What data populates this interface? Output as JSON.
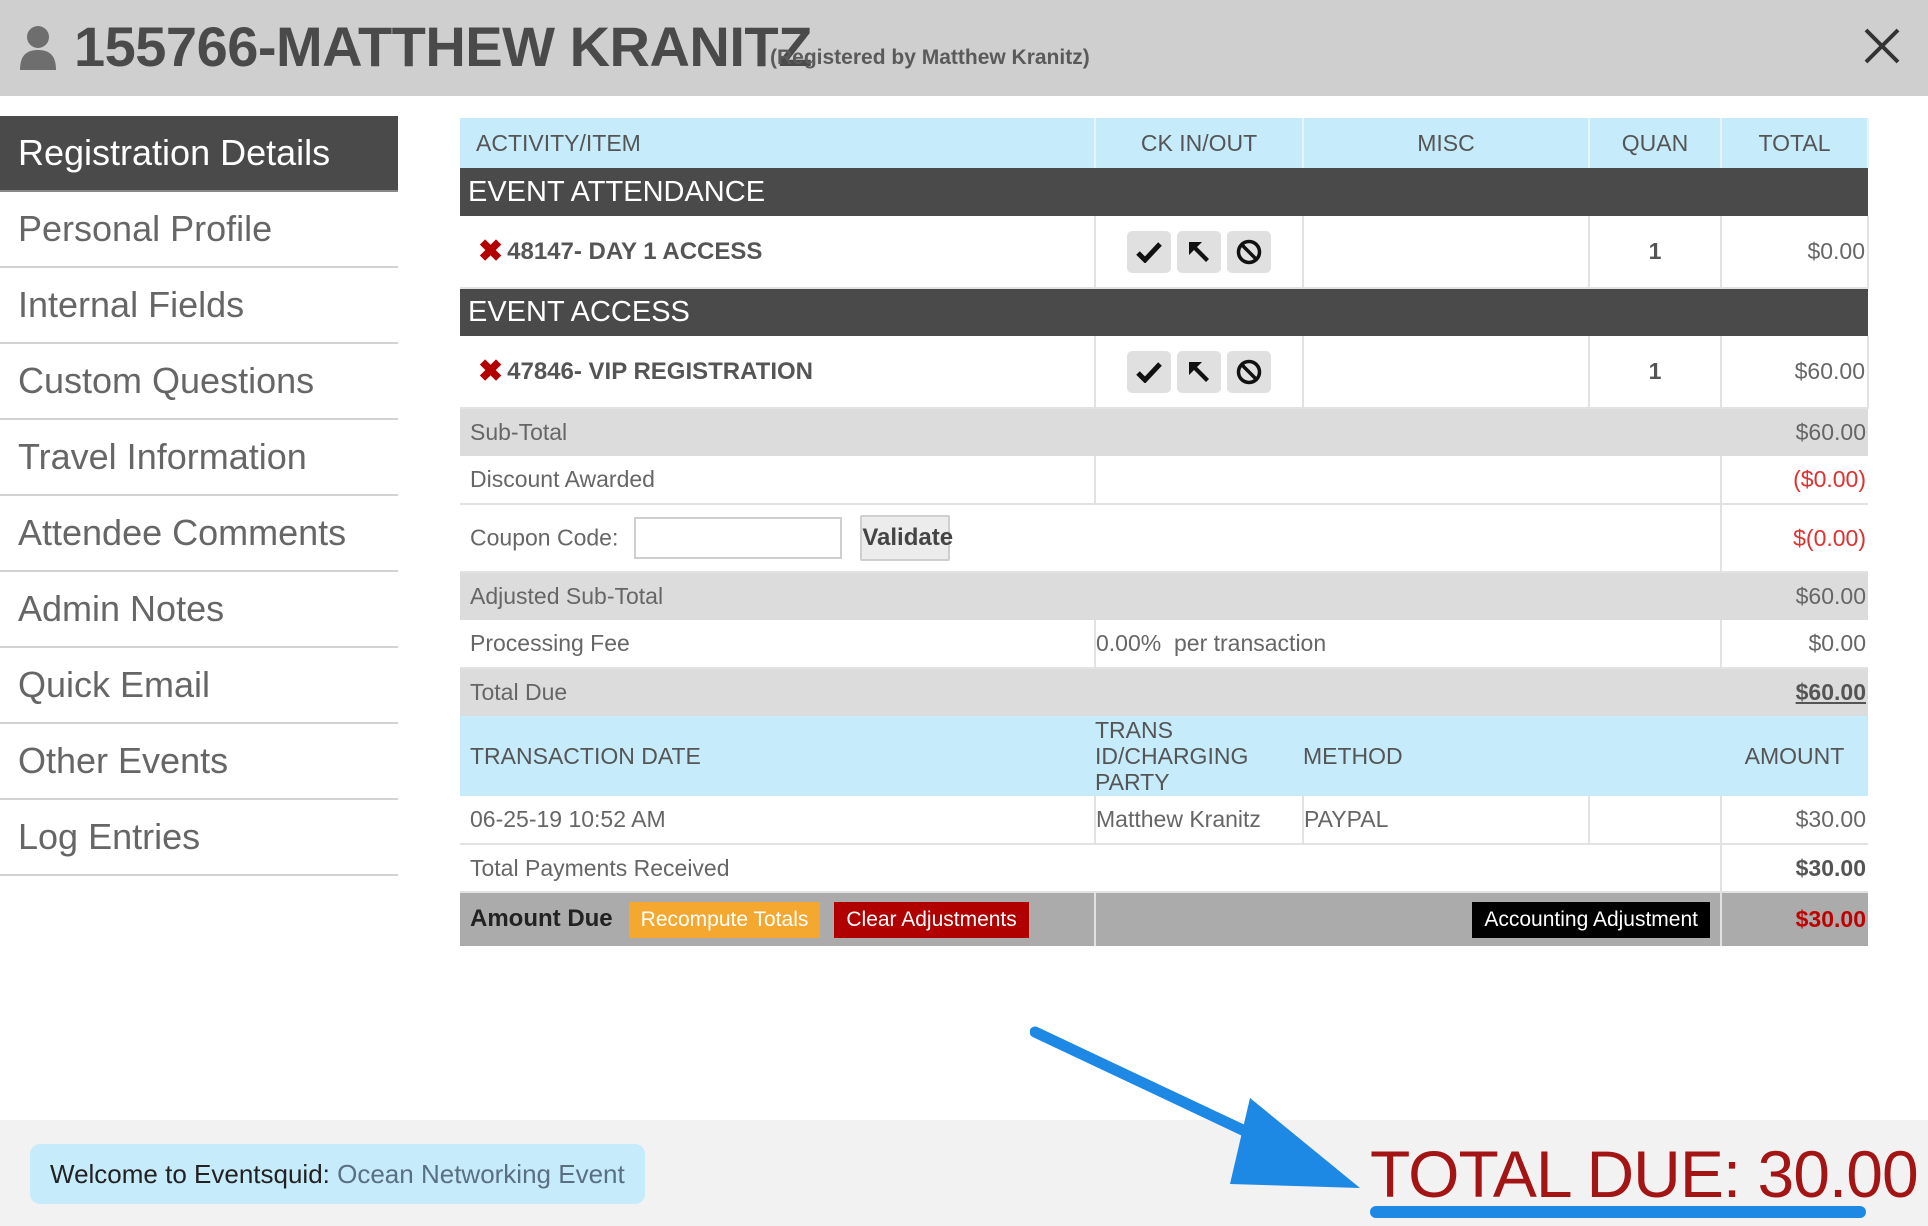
{
  "header": {
    "title": "155766-MATTHEW KRANITZ",
    "subtitle": "(Registered by Matthew Kranitz)"
  },
  "sidebar": {
    "items": [
      {
        "label": "Registration Details"
      },
      {
        "label": "Personal Profile"
      },
      {
        "label": "Internal Fields"
      },
      {
        "label": "Custom Questions"
      },
      {
        "label": "Travel Information"
      },
      {
        "label": "Attendee Comments"
      },
      {
        "label": "Admin Notes"
      },
      {
        "label": "Quick Email"
      },
      {
        "label": "Other Events"
      },
      {
        "label": "Log Entries"
      }
    ]
  },
  "table": {
    "headers": {
      "activity": "ACTIVITY/ITEM",
      "ck": "CK IN/OUT",
      "misc": "MISC",
      "quan": "QUAN",
      "total": "TOTAL"
    },
    "sections": [
      {
        "title": "EVENT ATTENDANCE",
        "item": {
          "name": "48147- DAY 1 ACCESS",
          "quan": "1",
          "total": "$0.00"
        }
      },
      {
        "title": "EVENT ACCESS",
        "item": {
          "name": "47846- VIP REGISTRATION",
          "quan": "1",
          "total": "$60.00"
        }
      }
    ],
    "subtotal": {
      "label": "Sub-Total",
      "value": "$60.00"
    },
    "discount": {
      "label": "Discount Awarded",
      "value": "($0.00)"
    },
    "coupon": {
      "label": "Coupon Code:",
      "button": "Validate",
      "value": "$(0.00)"
    },
    "adjusted": {
      "label": "Adjusted Sub-Total",
      "value": "$60.00"
    },
    "fee": {
      "label": "Processing Fee",
      "rate": "0.00%  per transaction",
      "value": "$0.00"
    },
    "total_due": {
      "label": "Total Due",
      "value": "$60.00"
    },
    "trans_headers": {
      "date": "TRANSACTION DATE",
      "party": "TRANS ID/CHARGING PARTY",
      "method": "METHOD",
      "amount": "AMOUNT"
    },
    "transactions": [
      {
        "date": "06-25-19 10:52 AM",
        "party": "Matthew Kranitz",
        "method": "PAYPAL",
        "amount": "$30.00"
      }
    ],
    "payments": {
      "label": "Total Payments Received",
      "value": "$30.00"
    },
    "amount_due": {
      "label": "Amount Due",
      "recompute": "Recompute Totals",
      "clear": "Clear Adjustments",
      "accounting": "Accounting Adjustment",
      "value": "$30.00"
    }
  },
  "footer": {
    "welcome_label": "Welcome to Eventsquid:",
    "event_name": "Ocean Networking Event"
  },
  "annotation": {
    "total_due_text": "TOTAL DUE: 30.00"
  },
  "colors": {
    "header_bg": "#cfcfcf",
    "active_nav": "#4a4a4a",
    "table_header": "#c6ebfb",
    "negative": "#e03030",
    "due_red": "#a31515",
    "arrow_blue": "#1e88e5"
  }
}
